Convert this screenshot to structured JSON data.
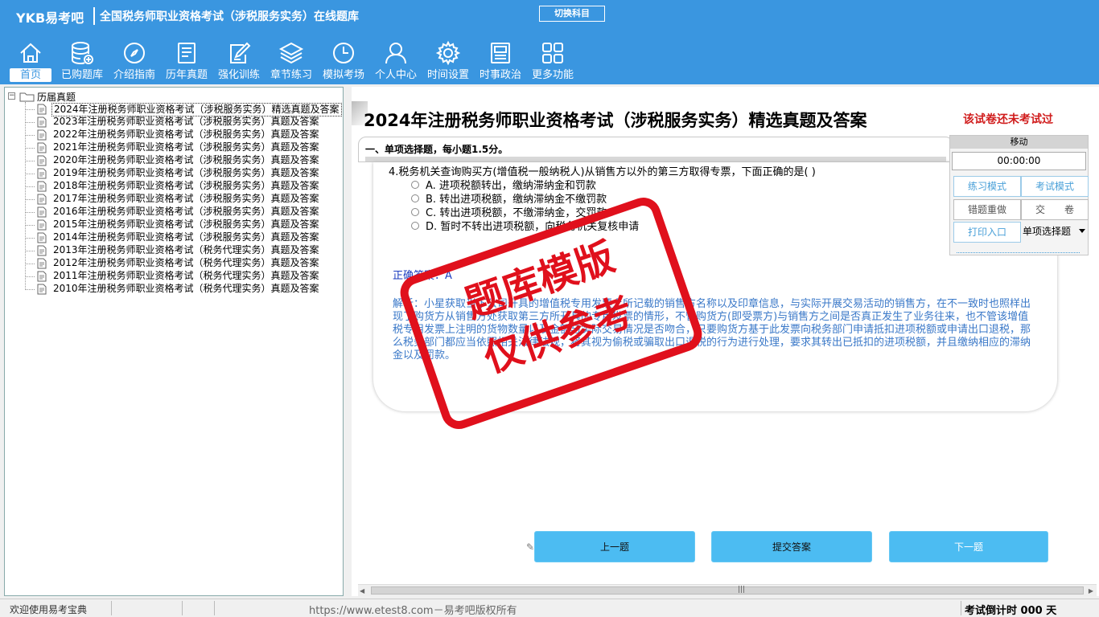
{
  "header": {
    "brand": "YKB易考吧",
    "title": "全国税务师职业资格考试（涉税服务实务）在线题库",
    "switch_subject": "切换科目"
  },
  "nav": [
    {
      "label": "首页",
      "icon": "home-icon",
      "active": true
    },
    {
      "label": "已购题库",
      "icon": "database-icon"
    },
    {
      "label": "介绍指南",
      "icon": "compass-icon"
    },
    {
      "label": "历年真题",
      "icon": "list-doc-icon"
    },
    {
      "label": "强化训练",
      "icon": "edit-icon"
    },
    {
      "label": "章节练习",
      "icon": "layers-icon"
    },
    {
      "label": "模拟考场",
      "icon": "clock-icon"
    },
    {
      "label": "个人中心",
      "icon": "user-icon"
    },
    {
      "label": "时间设置",
      "icon": "gear-icon"
    },
    {
      "label": "时事政治",
      "icon": "news-icon"
    },
    {
      "label": "更多功能",
      "icon": "grid-icon"
    }
  ],
  "tree": {
    "root": "历届真题",
    "items": [
      "2024年注册税务师职业资格考试（涉税服务实务）精选真题及答案",
      "2023年注册税务师职业资格考试（涉税服务实务）真题及答案",
      "2022年注册税务师职业资格考试（涉税服务实务）真题及答案",
      "2021年注册税务师职业资格考试（涉税服务实务）真题及答案",
      "2020年注册税务师职业资格考试（涉税服务实务）真题及答案",
      "2019年注册税务师职业资格考试（涉税服务实务）真题及答案",
      "2018年注册税务师职业资格考试（涉税服务实务）真题及答案",
      "2017年注册税务师职业资格考试（涉税服务实务）真题及答案",
      "2016年注册税务师职业资格考试（涉税服务实务）真题及答案",
      "2015年注册税务师职业资格考试（涉税服务实务）真题及答案",
      "2014年注册税务师职业资格考试（涉税服务实务）真题及答案",
      "2013年注册税务师职业资格考试（税务代理实务）真题及答案",
      "2012年注册税务师职业资格考试（税务代理实务）真题及答案",
      "2011年注册税务师职业资格考试（税务代理实务）真题及答案",
      "2010年注册税务师职业资格考试（税务代理实务）真题及答案"
    ]
  },
  "exam": {
    "paper_title": "2024年注册税务师职业资格考试（涉税服务实务）精选真题及答案",
    "status": "该试卷还未考试过",
    "section": "一、单项选择题，每小题1.5分。",
    "question": "4.税务机关查询购买方(增值税一般纳税人)从销售方以外的第三方取得专票，下面正确的是( )",
    "options": [
      "A. 进项税额转出，缴纳滞纳金和罚款",
      "B. 转出进项税额，缴纳滞纳金不缴罚款",
      "C. 转出进项税额，不缴滞纳金，交罚款",
      "D. 暂时不转出进项税额，向税务机关复核申请"
    ],
    "answer": "正确答案：A",
    "analysis": "解析：小星获取当下公司开具的增值税专用发票上所记载的销售方名称以及印章信息，与实际开展交易活动的销售方，在不一致时也照样出现了购货方从销售方处获取第三方所开具的专用发票的情形，不管购货方(即受票方)与销售方之间是否真正发生了业务往来，也不管该增值税专用发票上注明的货物数量以及金额与实际交易情况是否吻合，只要购货方基于此发票向税务部门申请抵扣进项税额或申请出口退税，那么税务部门都应当依照相关法律法规，将其视为偷税或骗取出口退税的行为进行处理，要求其转出已抵扣的进项税额，并且缴纳相应的滞纳金以及罚款。",
    "watermark_line1": "题库模版",
    "watermark_line2": "仅供参考"
  },
  "buttons": {
    "prev": "上一题",
    "submit": "提交答案",
    "next": "下一题"
  },
  "tools": {
    "move": "移动",
    "timer": "00:00:00",
    "practice_mode": "练习模式",
    "exam_mode": "考试模式",
    "redo_wrong": "错题重做",
    "hand_in": "交　　卷",
    "print": "打印入口",
    "question_type": "单项选择题"
  },
  "status": {
    "welcome": "欢迎使用易考宝典",
    "copyright": "https://www.etest8.com－易考吧版权所有",
    "countdown": "考试倒计时 000 天"
  },
  "colors": {
    "header_bg": "#3a96e0",
    "button_bg": "#4cbcf2",
    "watermark": "#e0101c",
    "status_red": "#d01c1c",
    "answer_blue": "#1a3bbf"
  }
}
